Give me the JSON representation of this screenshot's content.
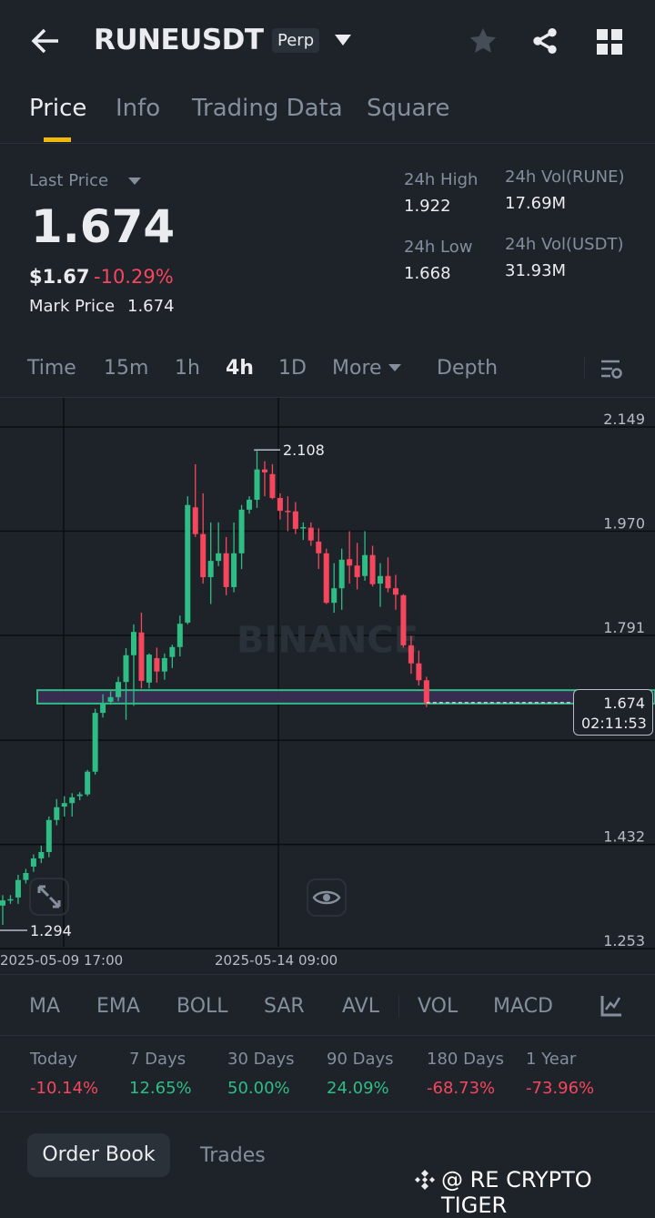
{
  "header": {
    "symbol": "RUNEUSDT",
    "contract_badge": "Perp"
  },
  "tabs": [
    {
      "label": "Price"
    },
    {
      "label": "Info"
    },
    {
      "label": "Trading Data"
    },
    {
      "label": "Square"
    }
  ],
  "ticker": {
    "last_price_label": "Last Price",
    "last_price": "1.674",
    "usd_price": "$1.67",
    "change_pct": "-10.29%",
    "mark_price_label": "Mark Price",
    "mark_price": "1.674",
    "high_label": "24h High",
    "high": "1.922",
    "low_label": "24h Low",
    "low": "1.668",
    "vol_base_label": "24h Vol(RUNE)",
    "vol_base": "17.69M",
    "vol_quote_label": "24h Vol(USDT)",
    "vol_quote": "31.93M"
  },
  "intervals": [
    {
      "label": "Time"
    },
    {
      "label": "15m"
    },
    {
      "label": "1h"
    },
    {
      "label": "4h"
    },
    {
      "label": "1D"
    },
    {
      "label": "More"
    },
    {
      "label": "Depth"
    }
  ],
  "chart_data": {
    "type": "candlestick",
    "title": "RUNEUSDT Perp 4h",
    "watermark": "BINANCE",
    "y_ticks": [
      "2.149",
      "1.970",
      "1.791",
      "1.432",
      "1.253"
    ],
    "ylim": [
      1.253,
      2.149
    ],
    "x_ticks": [
      "2025-05-09 17:00",
      "2025-05-14 09:00"
    ],
    "max_label": "2.108",
    "min_label": "1.294",
    "current_price": "1.674",
    "countdown": "02:11:53",
    "zone": [
      1.674,
      1.697
    ],
    "colors": {
      "up": "#2ebd85",
      "down": "#f6465d",
      "zone": "#3a2f55"
    },
    "ohlc": [
      [
        1.327,
        1.345,
        1.294,
        1.336
      ],
      [
        1.336,
        1.345,
        1.33,
        1.338
      ],
      [
        1.341,
        1.38,
        1.33,
        1.371
      ],
      [
        1.371,
        1.39,
        1.365,
        1.383
      ],
      [
        1.394,
        1.415,
        1.385,
        1.408
      ],
      [
        1.408,
        1.43,
        1.4,
        1.419
      ],
      [
        1.419,
        1.48,
        1.41,
        1.474
      ],
      [
        1.474,
        1.51,
        1.465,
        1.496
      ],
      [
        1.497,
        1.515,
        1.48,
        1.503
      ],
      [
        1.503,
        1.52,
        1.48,
        1.513
      ],
      [
        1.515,
        1.522,
        1.508,
        1.518
      ],
      [
        1.518,
        1.56,
        1.515,
        1.557
      ],
      [
        1.557,
        1.665,
        1.552,
        1.658
      ],
      [
        1.658,
        1.69,
        1.65,
        1.675
      ],
      [
        1.677,
        1.695,
        1.672,
        1.685
      ],
      [
        1.685,
        1.72,
        1.678,
        1.711
      ],
      [
        1.711,
        1.769,
        1.646,
        1.757
      ],
      [
        1.757,
        1.81,
        1.67,
        1.797
      ],
      [
        1.796,
        1.83,
        1.7,
        1.713
      ],
      [
        1.71,
        1.76,
        1.7,
        1.758
      ],
      [
        1.752,
        1.77,
        1.71,
        1.729
      ],
      [
        1.729,
        1.76,
        1.715,
        1.752
      ],
      [
        1.754,
        1.775,
        1.735,
        1.771
      ],
      [
        1.771,
        1.825,
        1.755,
        1.811
      ],
      [
        1.813,
        2.03,
        1.81,
        2.015
      ],
      [
        2.011,
        2.085,
        1.96,
        1.965
      ],
      [
        1.965,
        2.035,
        1.88,
        1.891
      ],
      [
        1.891,
        1.985,
        1.845,
        1.919
      ],
      [
        1.919,
        1.985,
        1.91,
        1.932
      ],
      [
        1.932,
        1.96,
        1.86,
        1.874
      ],
      [
        1.874,
        1.985,
        1.865,
        1.932
      ],
      [
        1.932,
        2.015,
        1.905,
        2.007
      ],
      [
        2.007,
        2.03,
        2.0,
        2.024
      ],
      [
        2.024,
        2.108,
        2.01,
        2.076
      ],
      [
        2.076,
        2.09,
        2.03,
        2.071
      ],
      [
        2.068,
        2.085,
        2.025,
        2.027
      ],
      [
        2.027,
        2.035,
        1.99,
        2.005
      ],
      [
        2.005,
        2.03,
        1.97,
        2.004
      ],
      [
        2.004,
        2.02,
        1.965,
        1.974
      ],
      [
        1.976,
        1.985,
        1.955,
        1.977
      ],
      [
        1.976,
        1.985,
        1.945,
        1.954
      ],
      [
        1.952,
        1.975,
        1.905,
        1.932
      ],
      [
        1.932,
        1.94,
        1.845,
        1.847
      ],
      [
        1.847,
        1.915,
        1.83,
        1.872
      ],
      [
        1.872,
        1.94,
        1.835,
        1.921
      ],
      [
        1.922,
        1.97,
        1.88,
        1.911
      ],
      [
        1.911,
        1.95,
        1.87,
        1.891
      ],
      [
        1.893,
        1.97,
        1.885,
        1.929
      ],
      [
        1.929,
        1.945,
        1.875,
        1.879
      ],
      [
        1.88,
        1.915,
        1.84,
        1.893
      ],
      [
        1.893,
        1.925,
        1.865,
        1.872
      ],
      [
        1.872,
        1.895,
        1.835,
        1.861
      ],
      [
        1.86,
        1.862,
        1.77,
        1.774
      ],
      [
        1.774,
        1.79,
        1.725,
        1.743
      ],
      [
        1.743,
        1.765,
        1.705,
        1.714
      ],
      [
        1.714,
        1.72,
        1.668,
        1.674
      ]
    ]
  },
  "indicators": [
    {
      "label": "MA"
    },
    {
      "label": "EMA"
    },
    {
      "label": "BOLL"
    },
    {
      "label": "SAR"
    },
    {
      "label": "AVL"
    },
    {
      "label": "VOL"
    },
    {
      "label": "MACD"
    }
  ],
  "performance": [
    {
      "label": "Today",
      "value": "-10.14%",
      "dir": "down"
    },
    {
      "label": "7 Days",
      "value": "12.65%",
      "dir": "up"
    },
    {
      "label": "30 Days",
      "value": "50.00%",
      "dir": "up"
    },
    {
      "label": "90 Days",
      "value": "24.09%",
      "dir": "up"
    },
    {
      "label": "180 Days",
      "value": "-68.73%",
      "dir": "down"
    },
    {
      "label": "1 Year",
      "value": "-73.96%",
      "dir": "down"
    }
  ],
  "bottom_tabs": [
    {
      "label": "Order Book"
    },
    {
      "label": "Trades"
    }
  ],
  "watermark_credit": "@ RE CRYPTO TIGER"
}
